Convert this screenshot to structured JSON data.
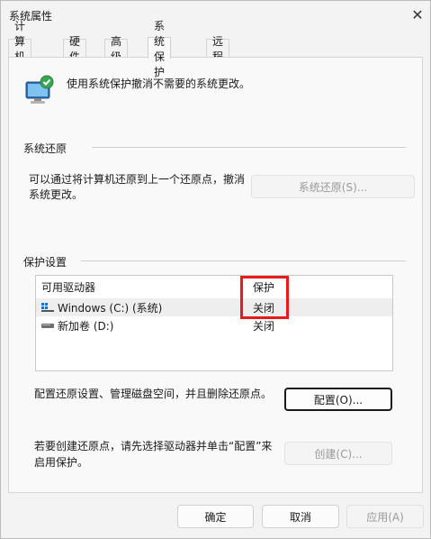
{
  "window": {
    "title": "系统属性"
  },
  "tabs": [
    {
      "label": "计算机名"
    },
    {
      "label": "硬件"
    },
    {
      "label": "高级"
    },
    {
      "label": "系统保护"
    },
    {
      "label": "远程"
    }
  ],
  "intro": {
    "text": "使用系统保护撤消不需要的系统更改。"
  },
  "restore_section": {
    "title": "系统还原",
    "description_line1": "可以通过将计算机还原到上一个还原点，撤消",
    "description_line2": "系统更改。",
    "button": "系统还原(S)..."
  },
  "protection_section": {
    "title": "保护设置",
    "columns": {
      "drive": "可用驱动器",
      "protection": "保护"
    },
    "drives": [
      {
        "name": "Windows (C:) (系统)",
        "protection": "关闭",
        "icon": "windows-drive-icon"
      },
      {
        "name": "新加卷 (D:)",
        "protection": "关闭",
        "icon": "drive-icon"
      }
    ],
    "configure_text": "配置还原设置、管理磁盘空间，并且删除还原点。",
    "configure_button": "配置(O)...",
    "create_text_line1": "若要创建还原点，请先选择驱动器并单击“配置”来",
    "create_text_line2": "启用保护。",
    "create_button": "创建(C)..."
  },
  "footer": {
    "ok": "确定",
    "cancel": "取消",
    "apply": "应用(A)"
  },
  "colors": {
    "highlight": "#e81a1a",
    "accent": "#0067c0"
  }
}
